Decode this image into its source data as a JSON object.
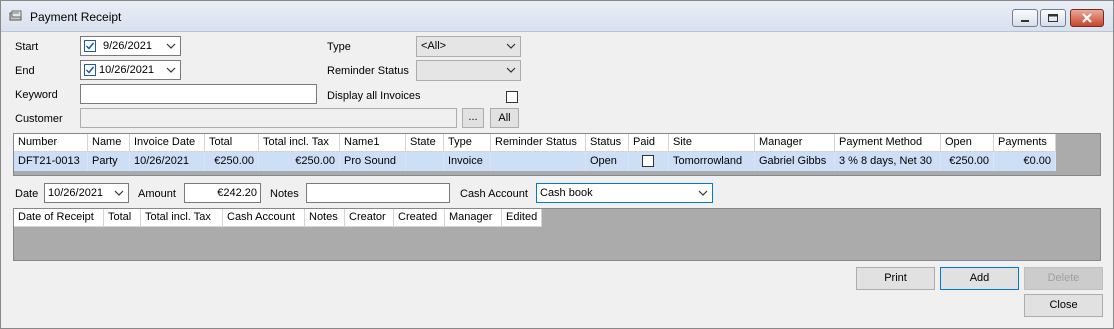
{
  "window": {
    "title": "Payment Receipt",
    "minimize_icon": "minimize-icon",
    "maximize_icon": "maximize-icon",
    "close_icon": "close-icon"
  },
  "filters": {
    "start_label": "Start",
    "start_value": "9/26/2021",
    "end_label": "End",
    "end_value": "10/26/2021",
    "keyword_label": "Keyword",
    "keyword_value": "",
    "customer_label": "Customer",
    "customer_value": "",
    "browse_label": "...",
    "all_label": "All",
    "type_label": "Type",
    "type_value": "<All>",
    "reminder_label": "Reminder Status",
    "reminder_value": "",
    "display_all_label": "Display all Invoices"
  },
  "invoices": {
    "headers": [
      "Number",
      "Name",
      "Invoice Date",
      "Total",
      "Total incl. Tax",
      "Name1",
      "State",
      "Type",
      "Reminder Status",
      "Status",
      "Paid",
      "Site",
      "Manager",
      "Payment Method",
      "Open",
      "Payments"
    ],
    "rows": [
      [
        "DFT21-0013",
        "Party",
        "10/26/2021",
        "€250.00",
        "€250.00",
        "Pro Sound",
        "",
        "Invoice",
        "",
        "Open",
        "",
        "Tomorrowland",
        "Gabriel Gibbs",
        "3 % 8 days, Net 30",
        "€250.00",
        "€0.00"
      ]
    ]
  },
  "payment": {
    "date_label": "Date",
    "date_value": "10/26/2021",
    "amount_label": "Amount",
    "amount_value": "€242.20",
    "notes_label": "Notes",
    "notes_value": "",
    "cash_label": "Cash Account",
    "cash_value": "Cash book"
  },
  "receipts": {
    "headers": [
      "Date of Receipt",
      "Total",
      "Total incl. Tax",
      "Cash Account",
      "Notes",
      "Creator",
      "Created",
      "Manager",
      "Edited"
    ]
  },
  "buttons": {
    "print": "Print",
    "add": "Add",
    "delete": "Delete",
    "close": "Close"
  },
  "colors": {
    "selection": "#cddff6",
    "grid_background": "#ababab",
    "focus_border": "#0078d7"
  }
}
